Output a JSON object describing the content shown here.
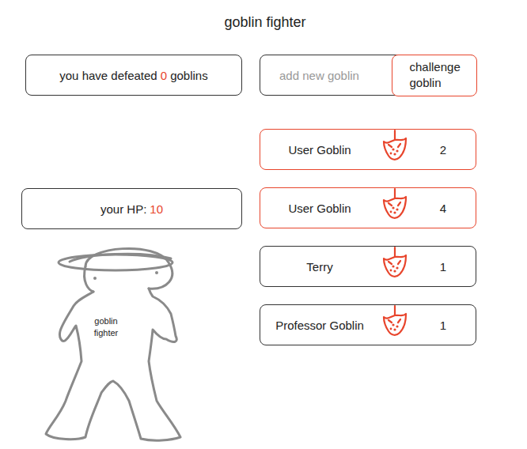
{
  "title": "goblin fighter",
  "stats": {
    "defeated_prefix": "you have defeated",
    "defeated_count": "0",
    "defeated_suffix": "goblins",
    "hp_label": "your HP:",
    "hp_value": "10"
  },
  "form": {
    "placeholder": "add new goblin",
    "button": "challenge goblin"
  },
  "fighter": {
    "label": "goblin fighter"
  },
  "goblins": [
    {
      "name": "User Goblin",
      "count": "2",
      "selected": true
    },
    {
      "name": "User Goblin",
      "count": "4",
      "selected": true
    },
    {
      "name": "Terry",
      "count": "1",
      "selected": false
    },
    {
      "name": "Professor Goblin",
      "count": "1",
      "selected": false
    }
  ]
}
